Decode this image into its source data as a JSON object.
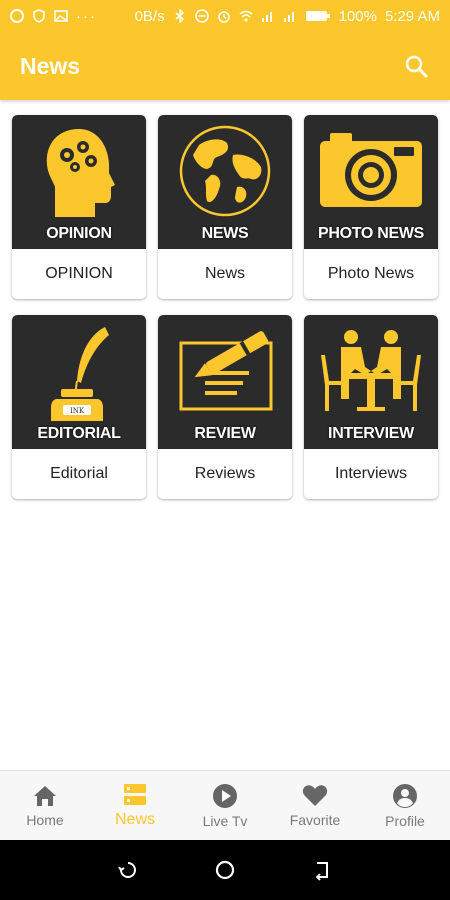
{
  "status_bar": {
    "speed": "0B/s",
    "battery": "100%",
    "time": "5:29 AM"
  },
  "app_bar": {
    "title": "News",
    "search_icon": "search-icon"
  },
  "colors": {
    "accent": "#fbc72c",
    "tile_bg": "#2b2b2b",
    "inactive": "#7a7a7a"
  },
  "categories": [
    {
      "image_label": "OPINION",
      "caption": "OPINION",
      "icon": "head-gears-icon"
    },
    {
      "image_label": "NEWS",
      "caption": "News",
      "icon": "globe-icon"
    },
    {
      "image_label": "PHOTO NEWS",
      "caption": "Photo News",
      "icon": "camera-icon"
    },
    {
      "image_label": "EDITORIAL",
      "caption": "Editorial",
      "icon": "quill-ink-icon"
    },
    {
      "image_label": "REVIEW",
      "caption": "Reviews",
      "icon": "pen-paper-icon"
    },
    {
      "image_label": "INTERVIEW",
      "caption": "Interviews",
      "icon": "interview-table-icon"
    }
  ],
  "bottom_nav": [
    {
      "label": "Home",
      "icon": "home-icon",
      "active": false
    },
    {
      "label": "News",
      "icon": "news-list-icon",
      "active": true
    },
    {
      "label": "Live Tv",
      "icon": "play-circle-icon",
      "active": false
    },
    {
      "label": "Favorite",
      "icon": "heart-icon",
      "active": false
    },
    {
      "label": "Profile",
      "icon": "profile-icon",
      "active": false
    }
  ],
  "ink_label": "INK"
}
